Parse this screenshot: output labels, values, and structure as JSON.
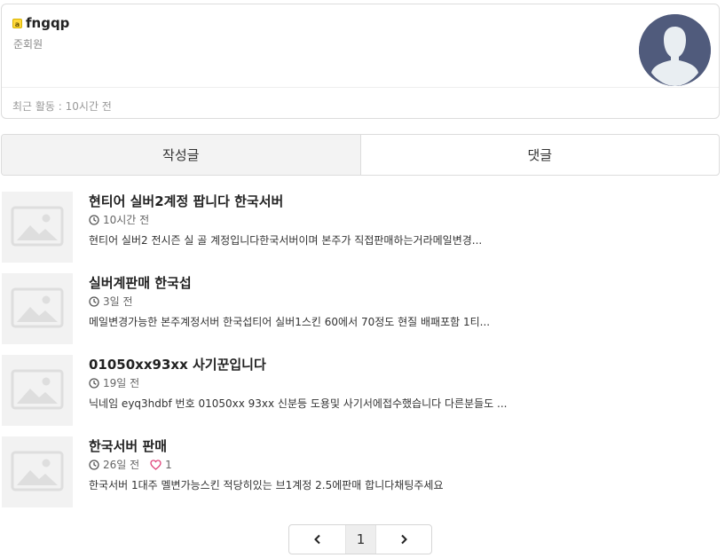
{
  "profile": {
    "level_badge": "a",
    "username": "fngqp",
    "rank": "준회원",
    "last_activity": "최근 활동 : 10시간 전"
  },
  "tabs": [
    {
      "label": "작성글",
      "active": true
    },
    {
      "label": "댓글",
      "active": false
    }
  ],
  "posts": [
    {
      "title": "현티어 실버2계정 팝니다 한국서버",
      "time": "10시간 전",
      "excerpt": "현티어 실버2 전시즌 실 골 계정입니다한국서버이며 본주가 직접판매하는거라메일변경..."
    },
    {
      "title": "실버계판매 한국섭",
      "time": "3일 전",
      "excerpt": "메일변경가능한 본주계정서버 한국섭티어 실버1스킨 60에서 70정도 현질 배패포함 1티..."
    },
    {
      "title": "01050xx93xx 사기꾼입니다",
      "time": "19일 전",
      "excerpt": "닉네임 eyq3hdbf 번호 01050xx 93xx 신분등 도용및 사기서에접수했습니다 다른분들도 ..."
    },
    {
      "title": "한국서버 판매",
      "time": "26일 전",
      "likes": "1",
      "excerpt": "한국서버 1대주 멜변가능스킨 적당히있는 브1계정 2.5에판매 합니다채팅주세요"
    }
  ],
  "pagination": {
    "prev": "‹",
    "current": "1",
    "next": "›"
  },
  "colors": {
    "avatar_bg": "#505b7c",
    "like_heart": "#e0457b"
  }
}
